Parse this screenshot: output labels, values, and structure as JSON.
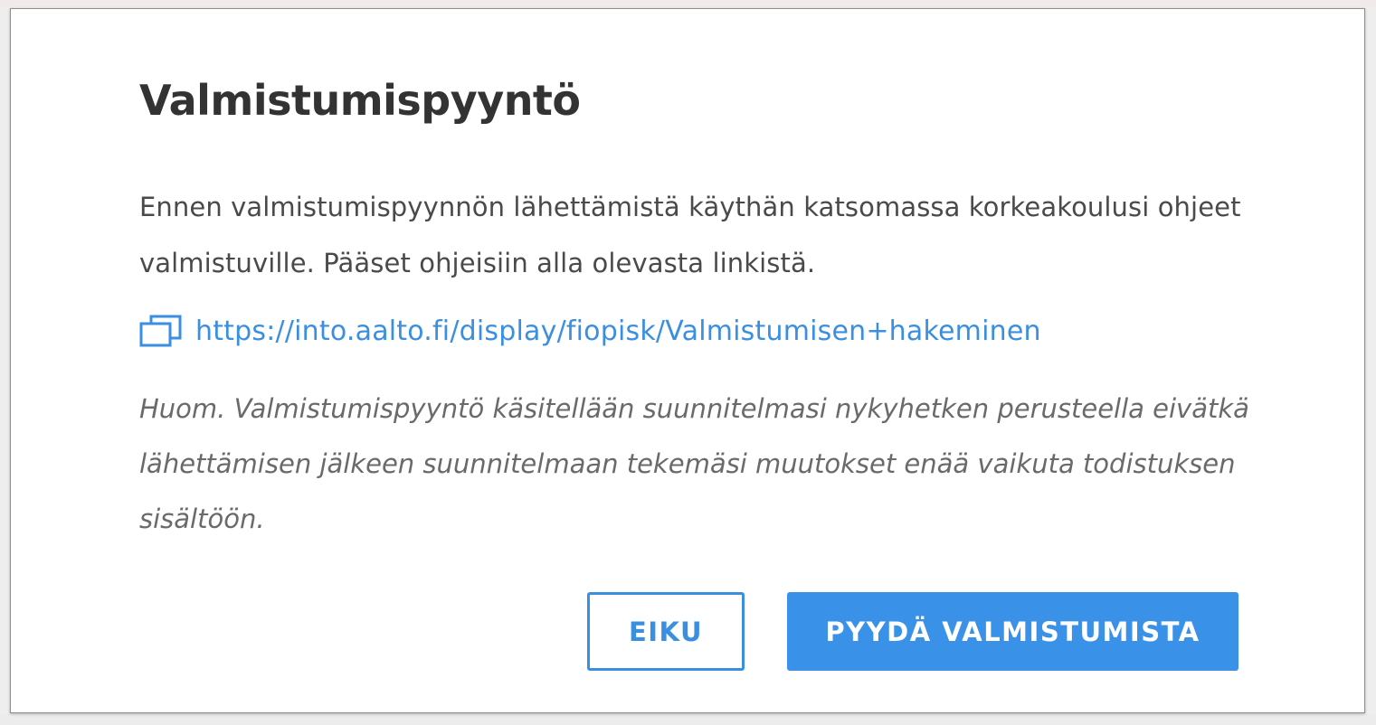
{
  "dialog": {
    "title": "Valmistumispyyntö",
    "intro": "Ennen valmistumispyynnön lähettämistä käythän katsomassa korkeakoulusi ohjeet valmistuville. Pääset ohjeisiin alla olevasta linkistä.",
    "link": {
      "icon": "external-link-icon",
      "text": "https://into.aalto.fi/display/fiopisk/Valmistumisen+hakeminen",
      "color": "#3a8fe0"
    },
    "note": "Huom. Valmistumispyyntö käsitellään suunnitelmasi nykyhetken perusteella eivätkä lähettämisen jälkeen suunnitelmaan tekemäsi muutokset enää vaikuta todistuksen sisältöön.",
    "buttons": {
      "cancel_label": "EIKU",
      "confirm_label": "PYYDÄ VALMISTUMISTA"
    },
    "colors": {
      "accent": "#3a92e8",
      "title": "#333333",
      "body_text": "#4a4a4a",
      "note_text": "#6a6a6a"
    }
  }
}
